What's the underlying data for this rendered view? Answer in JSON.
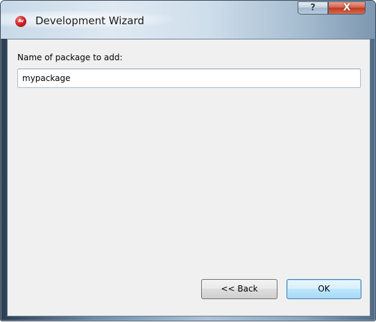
{
  "window": {
    "title": "Development Wizard",
    "app_icon_text": "Av",
    "help_label": "?",
    "close_label": "X"
  },
  "form": {
    "prompt_label": "Name of package to add:",
    "package_name_value": "mypackage"
  },
  "buttons": {
    "back_label": "<< Back",
    "ok_label": "OK"
  },
  "colors": {
    "app_icon": "#d02828",
    "close_button": "#c8452a",
    "client_background": "#f0f0f0",
    "default_button_border": "#3c7fb1"
  },
  "icons": {
    "app": "app-logo-icon",
    "help": "help-icon",
    "close": "close-icon"
  }
}
